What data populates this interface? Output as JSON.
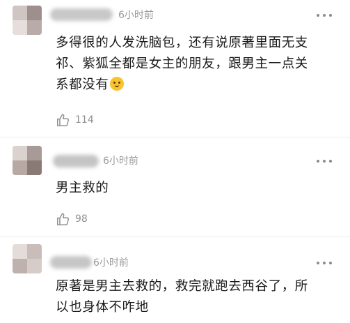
{
  "comments": [
    {
      "time": "6小时前",
      "text_lines": [
        "多得很的人发洗脑包，还有说原著里面无支",
        "祁、紫狐全都是女主的朋友，跟男主一点关",
        "系都没有"
      ],
      "emoji": "smile-emoji",
      "likes": "114"
    },
    {
      "time": "6小时前",
      "text_lines": [
        "男主救的"
      ],
      "likes": "98"
    },
    {
      "time": "6小时前",
      "text_lines": [
        "原著是男主去救的，救完就跑去西谷了，所",
        "以也身体不咋地"
      ]
    }
  ],
  "colors": {
    "text": "#1a1a1a",
    "meta": "#9a9a9a",
    "divider": "#ececec",
    "emoji": "#f7c32e"
  }
}
